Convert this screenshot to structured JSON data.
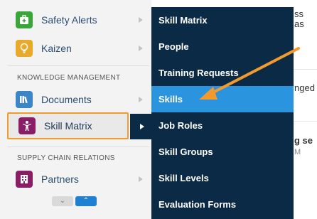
{
  "sidebar": {
    "items": [
      {
        "label": "Safety Alerts",
        "icon": "medical-kit-icon",
        "color": "#3aa63a"
      },
      {
        "label": "Kaizen",
        "icon": "lightbulb-icon",
        "color": "#e9a92b"
      },
      {
        "label": "Documents",
        "icon": "library-books-icon",
        "color": "#3a86c8"
      },
      {
        "label": "Skill Matrix",
        "icon": "person-star-icon",
        "color": "#8a1d66"
      },
      {
        "label": "Partners",
        "icon": "building-icon",
        "color": "#8a1d66"
      }
    ],
    "sections": {
      "knowledge": "KNOWLEDGE MANAGEMENT",
      "supply_chain": "SUPPLY CHAIN RELATIONS"
    },
    "scroll_down": "chevron-down-icon",
    "scroll_up": "chevron-up-icon"
  },
  "flyout": {
    "items": [
      {
        "label": "Skill Matrix"
      },
      {
        "label": "People"
      },
      {
        "label": "Training Requests"
      },
      {
        "label": "Skills"
      },
      {
        "label": "Job Roles"
      },
      {
        "label": "Skill Groups"
      },
      {
        "label": "Skill Levels"
      },
      {
        "label": "Evaluation Forms"
      }
    ],
    "active_color": "#2a95de",
    "background": "#0b2a45"
  },
  "background_page": {
    "fragments": [
      "ss",
      "as",
      "nged",
      "g se",
      "M"
    ]
  },
  "annotation": {
    "arrow_color": "#f39a2d"
  }
}
